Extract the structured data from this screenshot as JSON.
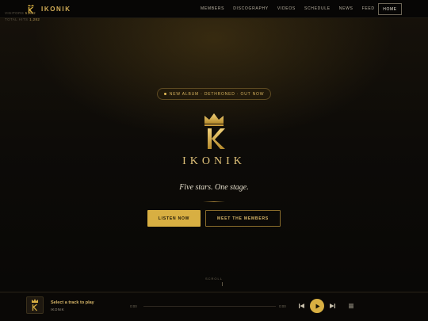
{
  "nav": {
    "brand": "IKONIK",
    "links": [
      "MEMBERS",
      "DISCOGRAPHY",
      "VIDEOS",
      "SCHEDULE",
      "NEWS",
      "FEED"
    ],
    "home_label": "HOME"
  },
  "hero": {
    "badge": "NEW ALBUM · DETHRONED · OUT NOW",
    "brand": "IKONIK",
    "tagline": "Five stars. One stage.",
    "primary_cta": "LISTEN NOW",
    "secondary_cta": "MEET THE MEMBERS",
    "scroll_hint": "SCROLL"
  },
  "player": {
    "visitors_label": "VISITORS",
    "visitors_value": "5,482",
    "hits_label": "TOTAL HITS",
    "hits_value": "1,282",
    "track_title": "Select a track to play",
    "track_artist": "IKONIK",
    "time_current": "0:00",
    "time_total": "0:00",
    "progress": 0
  },
  "colors": {
    "accent": "#d8af42",
    "background": "#0b0906"
  },
  "icons": [
    "crown-icon",
    "previous-icon",
    "play-icon",
    "next-icon",
    "playlist-icon"
  ]
}
